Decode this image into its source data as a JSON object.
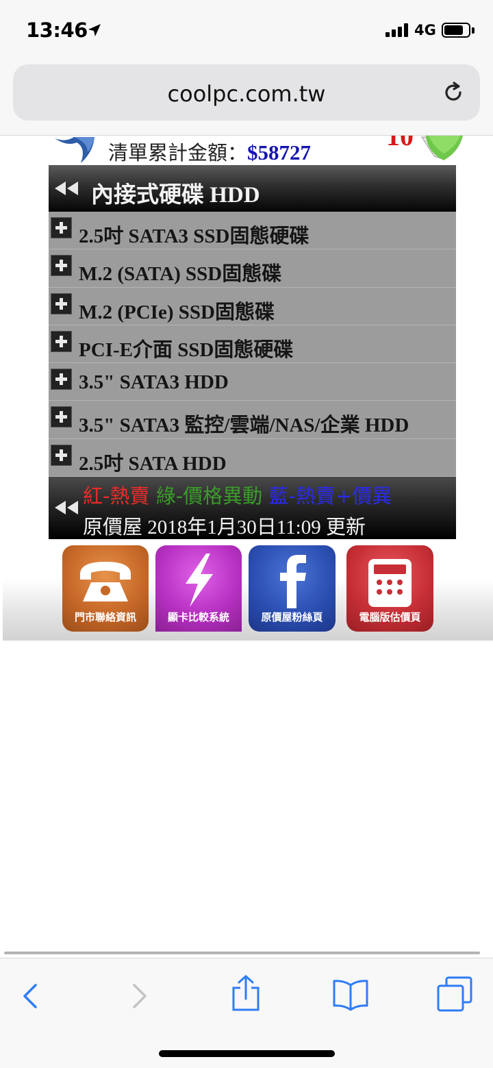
{
  "status_bar": {
    "time": "13:46",
    "network": "4G",
    "battery_level": 0.8
  },
  "browser": {
    "url": "coolpc.com.tw"
  },
  "page": {
    "cart_total_label": "清單累計金額：",
    "cart_total_value": "$58727",
    "menu_title": "內接式硬碟 HDD",
    "categories": [
      {
        "label": "2.5吋 SATA3 SSD固態硬碟"
      },
      {
        "label": "M.2 (SATA) SSD固態碟"
      },
      {
        "label": "M.2 (PCIe) SSD固態碟"
      },
      {
        "label": "PCI-E介面 SSD固態硬碟"
      },
      {
        "label": "3.5\" SATA3 HDD"
      },
      {
        "label": "3.5\" SATA3 監控/雲端/NAS/企業 HDD"
      },
      {
        "label": "2.5吋 SATA HDD"
      }
    ],
    "legend": {
      "red": "紅-熱賣",
      "green": "綠-價格異動",
      "blue": "藍-熱賣+價異",
      "colors": {
        "red": "#ee2a2a",
        "green": "#3b9b2a",
        "blue": "#2a2aee"
      }
    },
    "update_text": "原價屋 2018年1月30日11:09 更新",
    "tiles": [
      {
        "label": "門市聯絡資訊",
        "icon": "telephone-icon"
      },
      {
        "label": "顯卡比較系統",
        "icon": "lightning-icon"
      },
      {
        "label": "原價屋粉絲頁",
        "icon": "facebook-icon"
      },
      {
        "label": "電腦版估價頁",
        "icon": "calculator-icon"
      }
    ]
  },
  "toolbar": {
    "icons": [
      "back-icon",
      "forward-icon",
      "share-icon",
      "bookmarks-icon",
      "tabs-icon"
    ],
    "accent": "#2f7cf6"
  }
}
